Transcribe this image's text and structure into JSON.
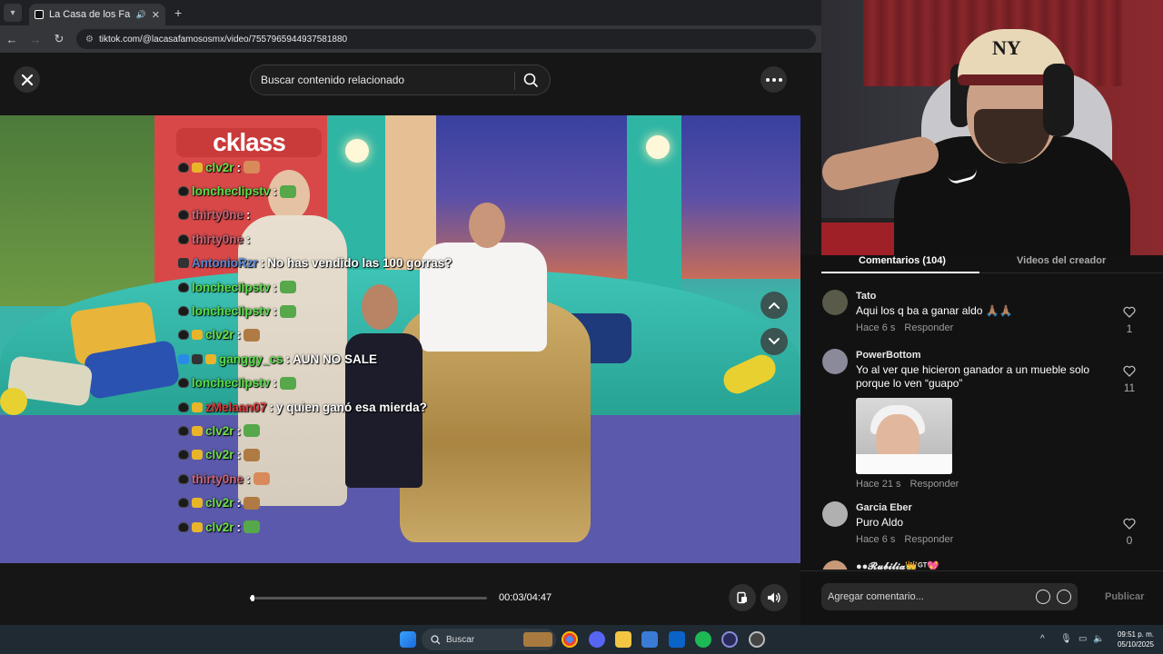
{
  "browser": {
    "tab_title": "La Casa de los Famosos |",
    "url": "tiktok.com/@lacasafamososmx/video/7557965944937581880"
  },
  "viewer": {
    "search_placeholder": "Buscar contenido relacionado",
    "video_logo": "cklass",
    "time_display": "00:03/04:47",
    "progress": 0.0106
  },
  "chat": [
    {
      "user": "clv2r",
      "color": "#6ee04a",
      "msg": "",
      "badges": [
        "cat",
        "crown"
      ],
      "emote": "#d88a5a"
    },
    {
      "user": "lonchecIipstv",
      "color": "#58e048",
      "msg": "",
      "badges": [
        "cat"
      ],
      "emote": "#56a84a"
    },
    {
      "user": "thirty0ne",
      "color": "#c86878",
      "msg": "",
      "badges": [
        "cat"
      ],
      "emote": ""
    },
    {
      "user": "thirty0ne",
      "color": "#c86878",
      "msg": "",
      "badges": [
        "cat"
      ],
      "emote": ""
    },
    {
      "user": "AntonioRzr",
      "color": "#5a8ad8",
      "msg": "No has vendido las 100 gorras?",
      "badges": [
        "dark"
      ],
      "emote": ""
    },
    {
      "user": "lonchecIipstv",
      "color": "#58e048",
      "msg": "",
      "badges": [
        "cat"
      ],
      "emote": "#56a84a"
    },
    {
      "user": "lonchecIipstv",
      "color": "#58e048",
      "msg": "",
      "badges": [
        "cat"
      ],
      "emote": "#56a84a"
    },
    {
      "user": "clv2r",
      "color": "#6ee04a",
      "msg": "",
      "badges": [
        "cat",
        "crown"
      ],
      "emote": "#b07a44"
    },
    {
      "user": "ganggy_cs",
      "color": "#58e048",
      "msg": "AUN NO SALE",
      "badges": [
        "blue",
        "dark",
        "crown"
      ],
      "emote": ""
    },
    {
      "user": "lonchecIipstv",
      "color": "#58e048",
      "msg": "",
      "badges": [
        "cat"
      ],
      "emote": "#56a84a"
    },
    {
      "user": "zMelaan07",
      "color": "#e03a3a",
      "msg": "y quien ganó esa mierda?",
      "badges": [
        "cat",
        "crown"
      ],
      "emote": ""
    },
    {
      "user": "clv2r",
      "color": "#6ee04a",
      "msg": "",
      "badges": [
        "cat",
        "crown"
      ],
      "emote": "#56a84a"
    },
    {
      "user": "clv2r",
      "color": "#6ee04a",
      "msg": "",
      "badges": [
        "cat",
        "crown"
      ],
      "emote": "#b07a44"
    },
    {
      "user": "thirty0ne",
      "color": "#c86878",
      "msg": "",
      "badges": [
        "cat"
      ],
      "emote": "#d88a5a"
    },
    {
      "user": "clv2r",
      "color": "#6ee04a",
      "msg": "",
      "badges": [
        "cat",
        "crown"
      ],
      "emote": "#b07a44"
    },
    {
      "user": "clv2r",
      "color": "#6ee04a",
      "msg": "",
      "badges": [
        "cat",
        "crown"
      ],
      "emote": "#56a84a"
    }
  ],
  "panel": {
    "tab_comments": "Comentarios (104)",
    "tab_creator": "Videos del creador",
    "comments": [
      {
        "user": "Tato",
        "text": "Aqui los q ba a ganar aldo 🙏🏽🙏🏽",
        "time": "Hace 6 s",
        "reply": "Responder",
        "likes": "1",
        "avatar": "#5a5a4a"
      },
      {
        "user": "PowerBottom",
        "text": "Yo al ver que hicieron ganador a un mueble solo porque lo ven “guapo”",
        "time": "Hace 21 s",
        "reply": "Responder",
        "likes": "11",
        "avatar": "#8a8a9a"
      },
      {
        "user": "Garcia Eber",
        "text": "Puro Aldo",
        "time": "Hace 6 s",
        "reply": "Responder",
        "likes": "0",
        "avatar": "#b0b0b0"
      },
      {
        "user": "●●𝓡𝓾𝓫𝓲𝓵𝓲𝓪👑ᴳᵀ💖",
        "avatar": "#c89a7a"
      }
    ],
    "input_placeholder": "Agregar comentario...",
    "publish": "Publicar"
  },
  "taskbar": {
    "search_label": "Buscar",
    "time": "09:51 p. m.",
    "date": "05/10/2025"
  },
  "colors": {
    "accent_red": "#fe2c55",
    "panel_bg": "#121212"
  }
}
